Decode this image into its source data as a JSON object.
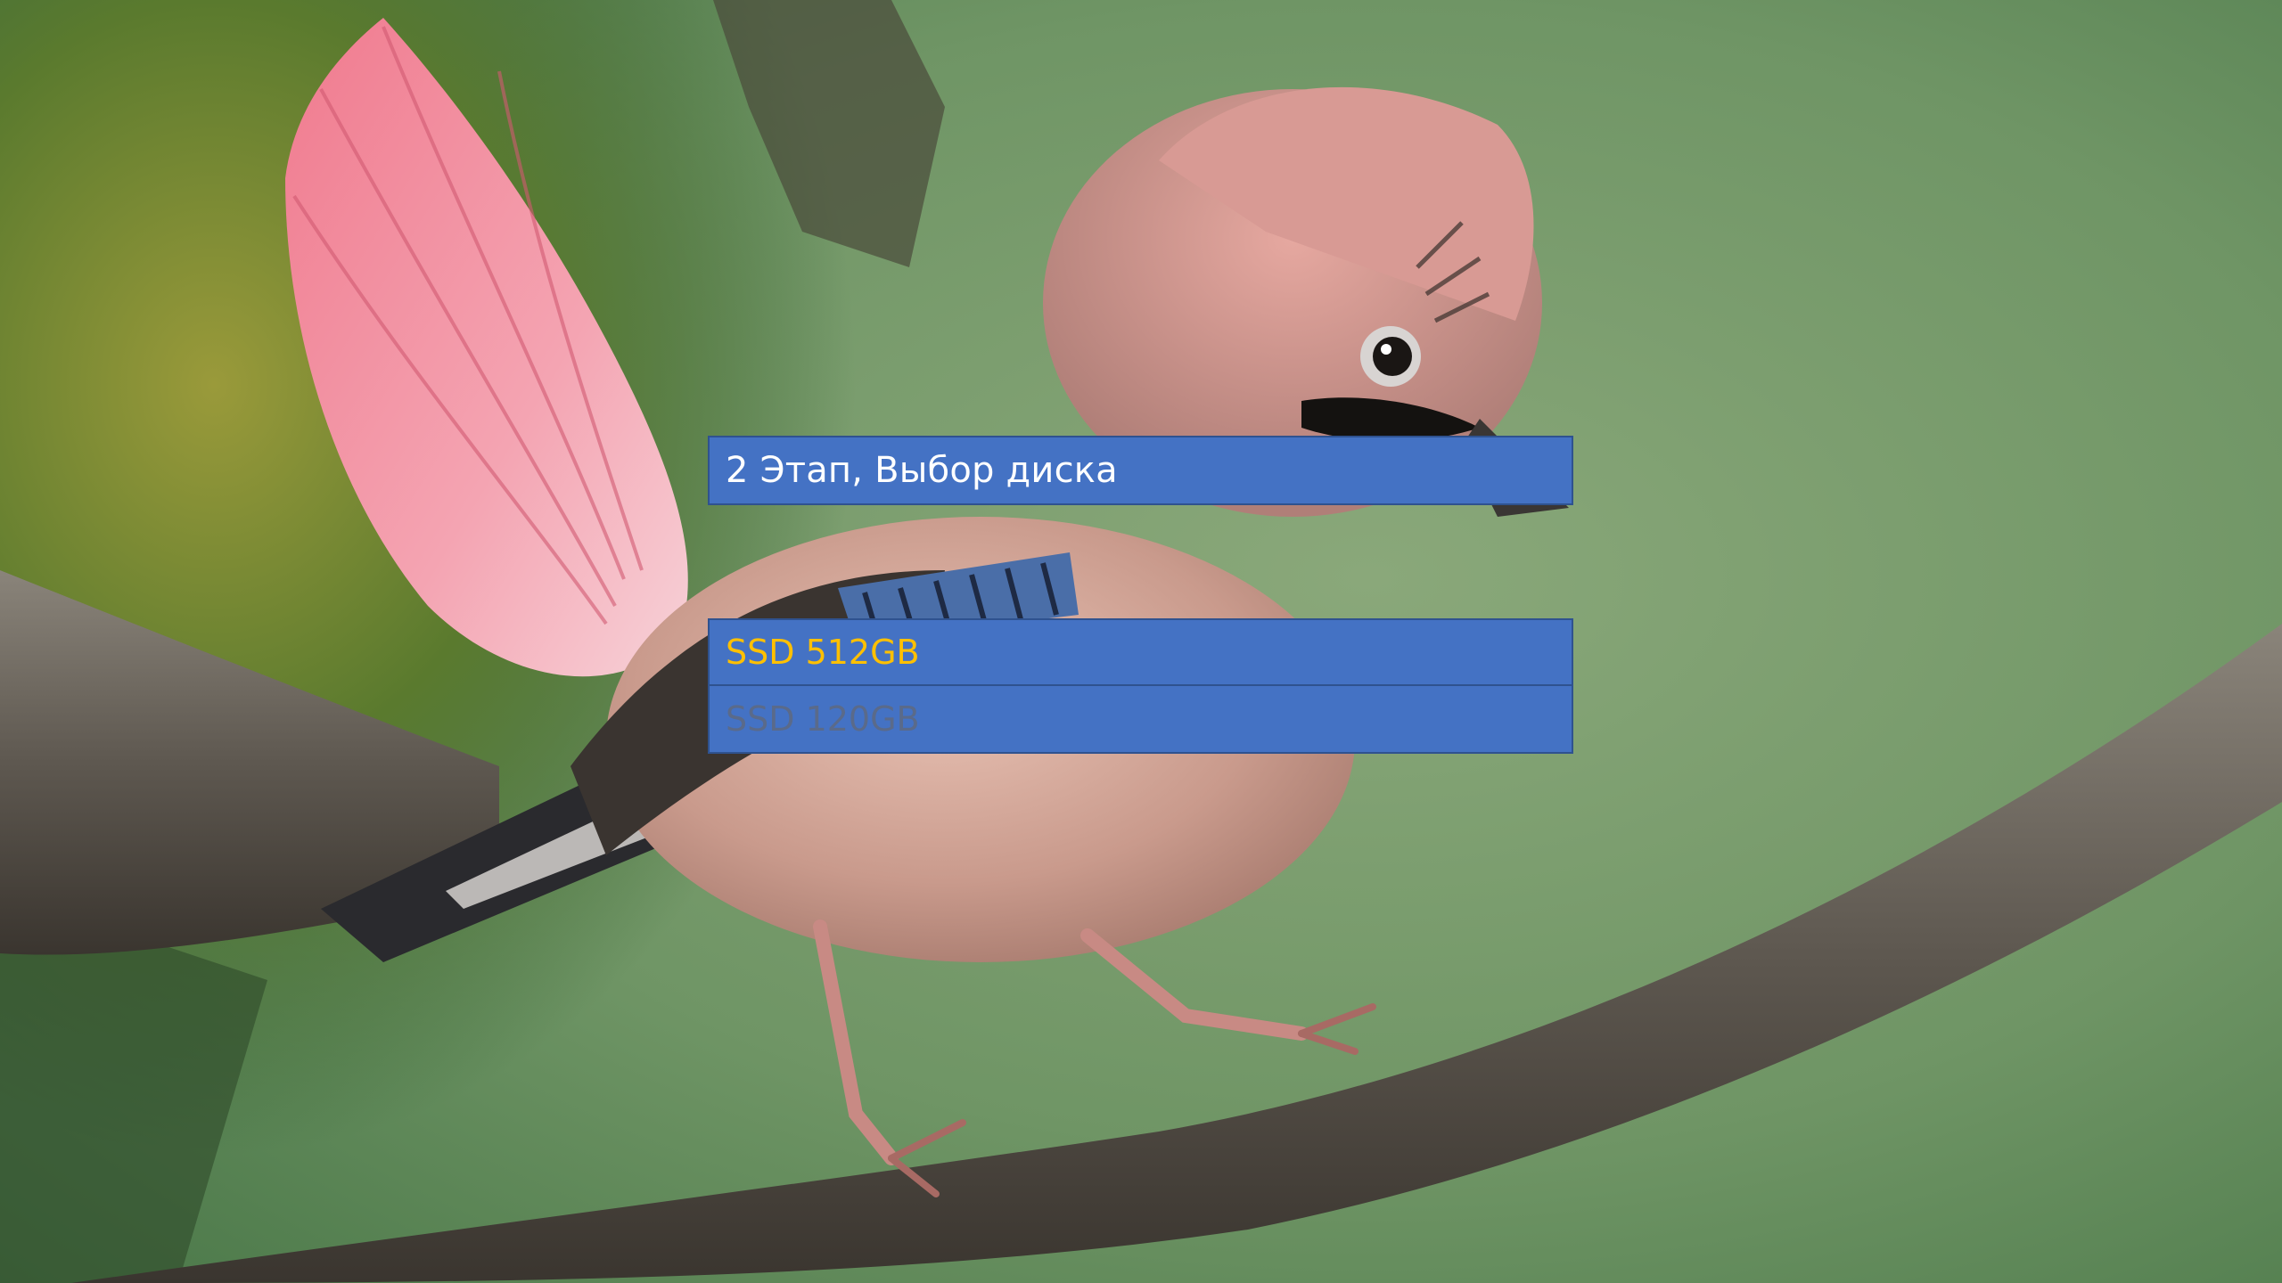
{
  "installer": {
    "stage_title": "2 Этап, Выбор диска",
    "disks": [
      {
        "label": "SSD 512GB",
        "state": "selected",
        "color": "#ffc000"
      },
      {
        "label": "SSD 120GB",
        "state": "normal",
        "color": "#5a6a8a"
      }
    ]
  },
  "colors": {
    "panel_fill": "#4472c4",
    "panel_border": "#2f528f",
    "title_text": "#ffffff"
  }
}
